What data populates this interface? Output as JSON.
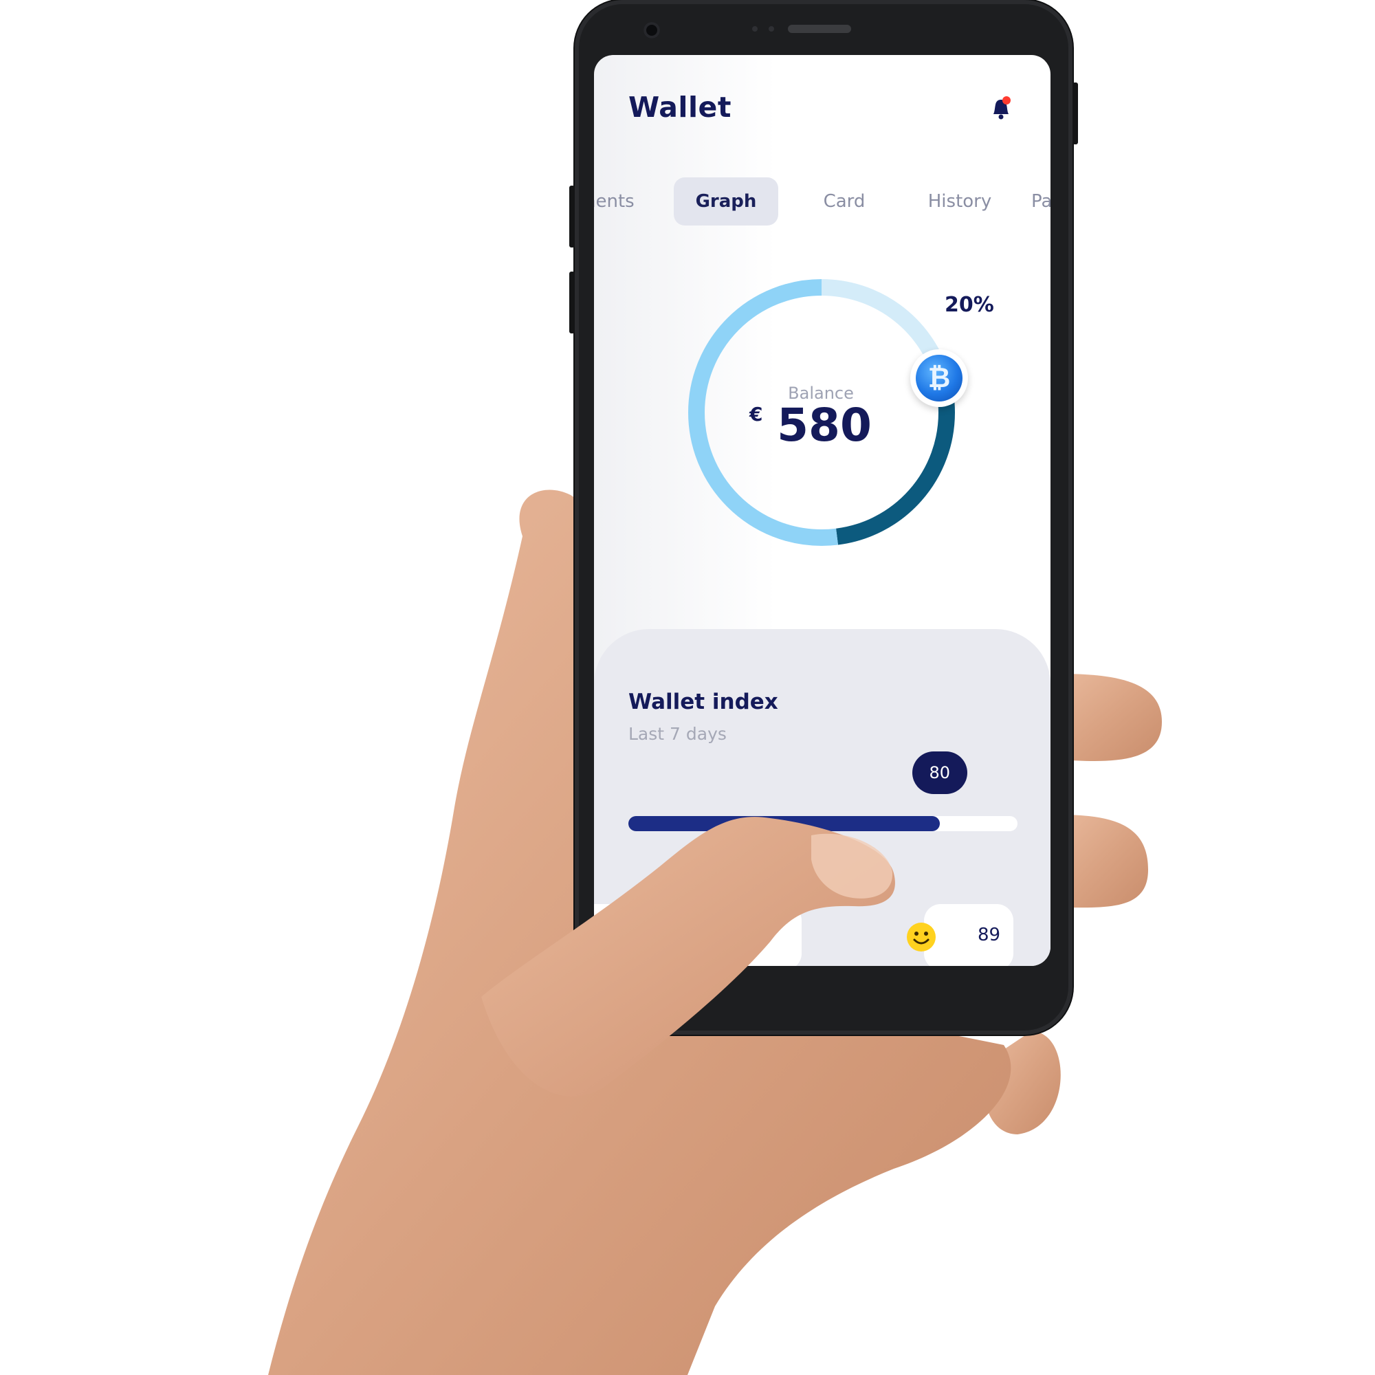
{
  "header": {
    "title": "Wallet"
  },
  "tabs": [
    {
      "label": "nents",
      "active": false
    },
    {
      "label": "Graph",
      "active": true
    },
    {
      "label": "Card",
      "active": false
    },
    {
      "label": "History",
      "active": false
    },
    {
      "label": "Pa",
      "active": false
    }
  ],
  "balance": {
    "label": "Balance",
    "currency": "€",
    "value": "580",
    "percent": "20%"
  },
  "donut": {
    "segments": [
      {
        "fraction": 0.2,
        "color": "#d4ecf9"
      },
      {
        "fraction": 0.28,
        "color": "#0c5a7e"
      },
      {
        "fraction": 0.52,
        "color": "#8fd3f7"
      }
    ]
  },
  "wallet_index": {
    "title": "Wallet index",
    "subtitle": "Last 7 days",
    "value": 80,
    "value_label": "80",
    "max": 100
  },
  "mood": {
    "value": "89",
    "icon": "smiley-icon"
  },
  "icons": {
    "bell": "bell-icon",
    "coin": "bitcoin-icon"
  },
  "colors": {
    "primary": "#141a5a",
    "accent": "#1c2d86",
    "notification": "#ff3b30"
  }
}
